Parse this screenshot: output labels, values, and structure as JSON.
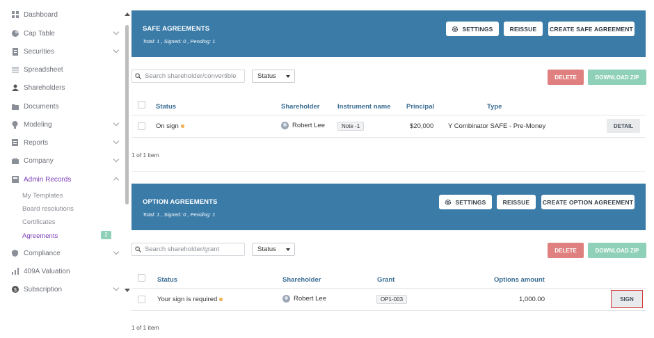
{
  "sidebar": {
    "items": [
      {
        "label": "Dashboard",
        "icon": "dashboard-icon"
      },
      {
        "label": "Cap Table",
        "icon": "pie-chart-icon",
        "expandable": true
      },
      {
        "label": "Securities",
        "icon": "document-stack-icon",
        "expandable": true
      },
      {
        "label": "Spreadsheet",
        "icon": "spreadsheet-icon"
      },
      {
        "label": "Shareholders",
        "icon": "person-icon"
      },
      {
        "label": "Documents",
        "icon": "folder-icon"
      },
      {
        "label": "Modeling",
        "icon": "lightbulb-icon",
        "expandable": true
      },
      {
        "label": "Reports",
        "icon": "report-icon",
        "expandable": true
      },
      {
        "label": "Company",
        "icon": "briefcase-icon",
        "expandable": true
      },
      {
        "label": "Admin Records",
        "icon": "records-icon",
        "expandable": true,
        "active": true
      },
      {
        "label": "Compliance",
        "icon": "shield-icon",
        "expandable": true
      },
      {
        "label": "409A Valuation",
        "icon": "bar-chart-icon"
      },
      {
        "label": "Subscription",
        "icon": "dollar-circle-icon",
        "expandable": true
      }
    ],
    "sub_items": [
      {
        "label": "My Templates"
      },
      {
        "label": "Board resolutions"
      },
      {
        "label": "Certificates"
      },
      {
        "label": "Agreements",
        "active": true
      }
    ],
    "agreements_badge": "2"
  },
  "safe": {
    "title": "SAFE AGREEMENTS",
    "summary": "Total: 1 , Signed: 0 , Pending: 1",
    "settings_label": "SETTINGS",
    "reissue_label": "REISSUE",
    "create_label": "CREATE SAFE AGREEMENT",
    "search_placeholder": "Search shareholder/convertible",
    "status_select": "Status",
    "delete_label": "DELETE",
    "download_label": "DOWNLOAD ZIP",
    "columns": {
      "status": "Status",
      "shareholder": "Shareholder",
      "instrument": "Instrument name",
      "principal": "Principal",
      "type": "Type"
    },
    "rows": [
      {
        "status": "On sign",
        "shareholder": "Robert Lee",
        "instrument": "Note -1",
        "principal": "$20,000",
        "type": "Y Combinator SAFE - Pre-Money",
        "action": "DETAIL"
      }
    ],
    "count": "1 of 1 item"
  },
  "option": {
    "title": "OPTION AGREEMENTS",
    "summary": "Total: 1 , Signed: 0 , Pending: 1",
    "settings_label": "SETTINGS",
    "reissue_label": "REISSUE",
    "create_label": "CREATE OPTION AGREEMENT",
    "search_placeholder": "Search shareholder/grant",
    "status_select": "Status",
    "delete_label": "DELETE",
    "download_label": "DOWNLOAD ZIP",
    "columns": {
      "status": "Status",
      "shareholder": "Shareholder",
      "grant": "Grant",
      "options_amount": "Options amount"
    },
    "rows": [
      {
        "status": "Your sign is required",
        "shareholder": "Robert Lee",
        "grant": "OP1-003",
        "options_amount": "1,000.00",
        "action": "SIGN"
      }
    ],
    "count": "1 of 1 item"
  },
  "colors": {
    "header_blue": "#3a7ba8",
    "accent_purple": "#7b3fb5",
    "delete_red": "#e07f7f",
    "zip_green": "#8fd0b9",
    "pending_dot": "#f0ad4e"
  }
}
